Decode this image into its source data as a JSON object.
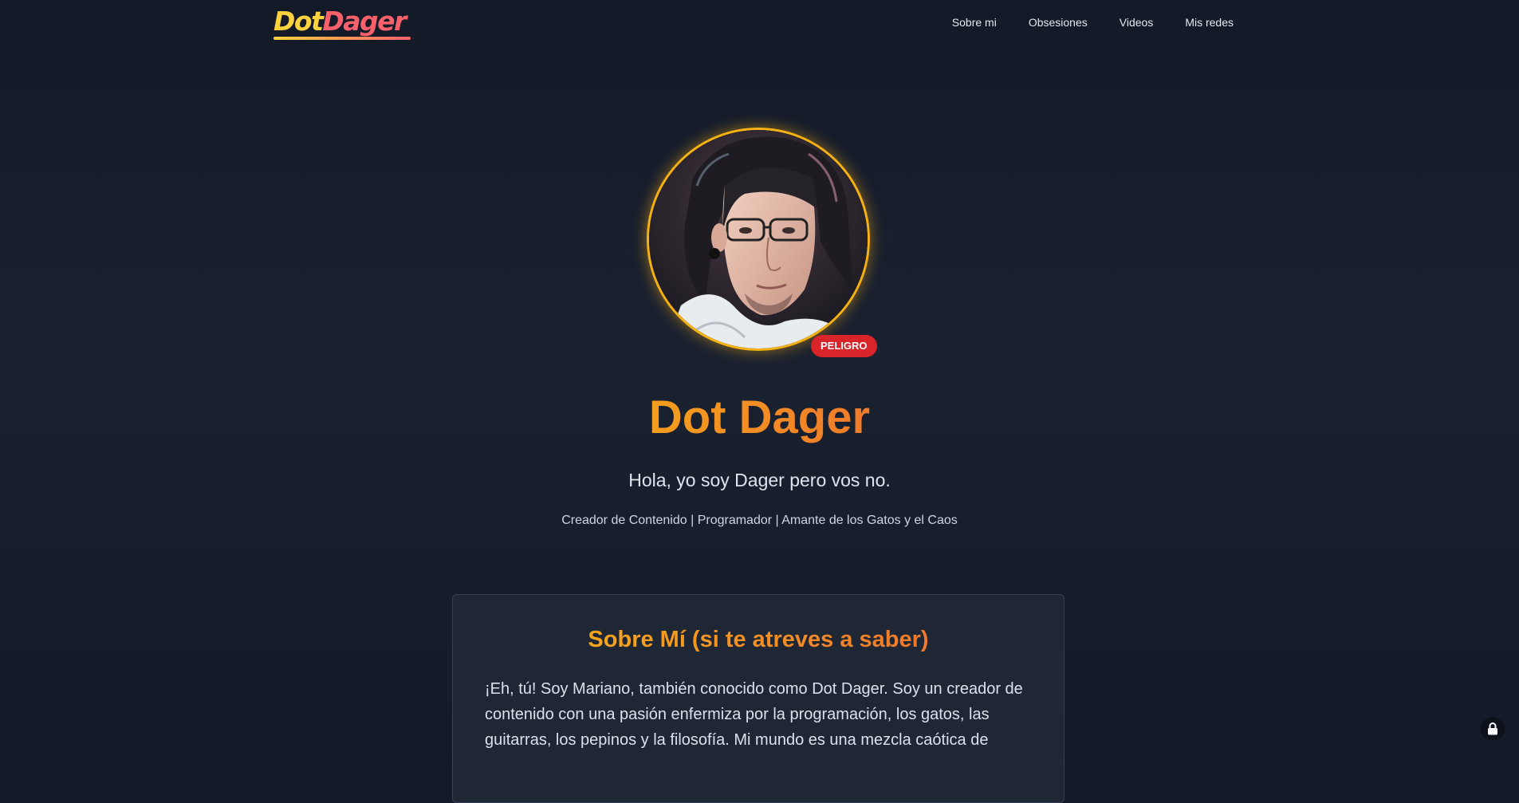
{
  "header": {
    "logo": {
      "part1": "Dot",
      "part2": "Dager"
    },
    "nav": [
      {
        "label": "Sobre mi"
      },
      {
        "label": "Obsesiones"
      },
      {
        "label": "Videos"
      },
      {
        "label": "Mis redes"
      }
    ]
  },
  "hero": {
    "avatar_icon": "profile-portrait",
    "badge": "PELIGRO",
    "title": "Dot Dager",
    "subtitle": "Hola, yo soy Dager pero vos no.",
    "tagline": "Creador de Contenido | Programador | Amante de los Gatos y el Caos"
  },
  "about": {
    "title": "Sobre Mí (si te atreves a saber)",
    "text": "¡Eh, tú! Soy Mariano, también conocido como Dot Dager. Soy un creador de contenido con una pasión enfermiza por la programación, los gatos, las guitarras, los pepinos y la filosofía. Mi mundo es una mezcla caótica de"
  },
  "colors": {
    "background": "#161d2b",
    "accent_orange": "#f28a24",
    "ring_gold": "#f5b211",
    "badge_red": "#d9252a",
    "logo_yellow": "#fcd33e",
    "logo_pink": "#f8606c"
  },
  "icons": {
    "floating_button": "lock-icon"
  }
}
